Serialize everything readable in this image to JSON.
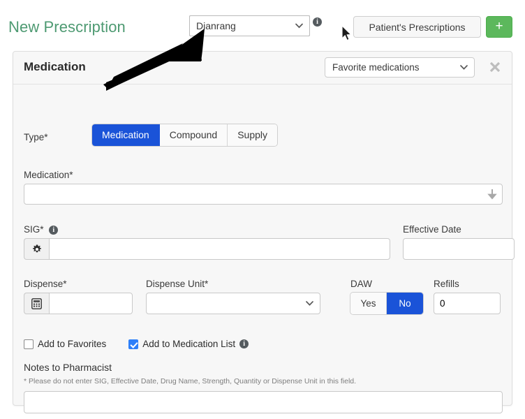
{
  "header": {
    "title": "New Prescription",
    "patient_select": {
      "value": "Dianrang",
      "icon": "chevron-down-icon"
    },
    "info_icon": "info-icon",
    "patient_prescriptions_button": "Patient's Prescriptions",
    "add_button": "+",
    "accent_green": "#5cb85c",
    "title_color": "#4e9a72"
  },
  "panel": {
    "title": "Medication",
    "favorite_select": {
      "value": "Favorite medications"
    },
    "close_icon": "close-icon",
    "type": {
      "label": "Type*",
      "options": [
        "Medication",
        "Compound",
        "Supply"
      ],
      "selected": "Medication",
      "active_color": "#1a53d8"
    },
    "medication": {
      "label": "Medication*",
      "value": "",
      "placeholder": "",
      "dropdown_icon": "down-arrow-icon"
    },
    "sig": {
      "label": "SIG*",
      "info_icon": "info-icon",
      "gear_icon": "gear-icon",
      "value": "",
      "placeholder": ""
    },
    "effective_date": {
      "label": "Effective Date",
      "value": "",
      "placeholder": ""
    },
    "dispense": {
      "label": "Dispense*",
      "calculator_icon": "calculator-icon",
      "value": "",
      "placeholder": ""
    },
    "dispense_unit": {
      "label": "Dispense Unit*",
      "value": "",
      "icon": "chevron-down-icon"
    },
    "daw": {
      "label": "DAW",
      "options": [
        "Yes",
        "No"
      ],
      "selected": "No"
    },
    "refills": {
      "label": "Refills",
      "value": "0"
    },
    "checkboxes": [
      {
        "label": "Add to Favorites",
        "checked": false,
        "info": false
      },
      {
        "label": "Add to Medication List",
        "checked": true,
        "info": true
      }
    ],
    "notes": {
      "title": "Notes to Pharmacist",
      "hint": "* Please do not enter SIG, Effective Date, Drug Name, Strength, Quantity or Dispense Unit in this field.",
      "value": "",
      "placeholder": ""
    }
  },
  "annotation": {
    "arrow": "black-pointer-arrow",
    "cursor": "mouse-cursor"
  }
}
